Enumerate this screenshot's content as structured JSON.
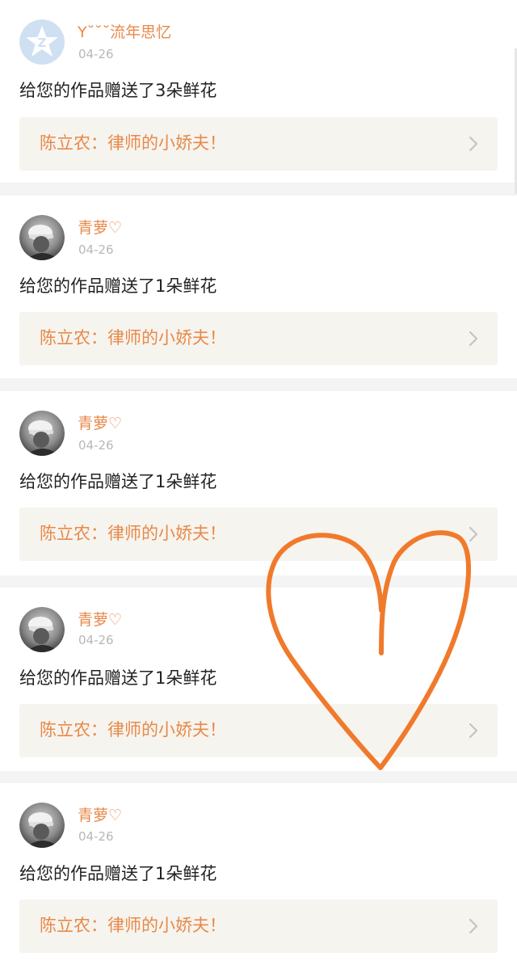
{
  "colors": {
    "username": "#e8894a",
    "date": "#b7b7b7",
    "message": "#222222",
    "link_bg": "#f6f4ee",
    "separator": "#f4f4f4",
    "heart": "#f07a2c"
  },
  "notifications": [
    {
      "username": "Y˘˘˘流年思忆",
      "date": "04-26",
      "message": "给您的作品赠送了3朵鲜花",
      "work_title": "陈立农：律师的小娇夫！",
      "avatar": "default-avatar-z-icon"
    },
    {
      "username": "青萝♡",
      "date": "04-26",
      "message": "给您的作品赠送了1朵鲜花",
      "work_title": "陈立农：律师的小娇夫！",
      "avatar": "user-photo-avatar"
    },
    {
      "username": "青萝♡",
      "date": "04-26",
      "message": "给您的作品赠送了1朵鲜花",
      "work_title": "陈立农：律师的小娇夫！",
      "avatar": "user-photo-avatar"
    },
    {
      "username": "青萝♡",
      "date": "04-26",
      "message": "给您的作品赠送了1朵鲜花",
      "work_title": "陈立农：律师的小娇夫！",
      "avatar": "user-photo-avatar"
    },
    {
      "username": "青萝♡",
      "date": "04-26",
      "message": "给您的作品赠送了1朵鲜花",
      "work_title": "陈立农：律师的小娇夫！",
      "avatar": "user-photo-avatar"
    }
  ],
  "overlay": {
    "shape": "hand-drawn-heart",
    "color": "#f07a2c"
  }
}
